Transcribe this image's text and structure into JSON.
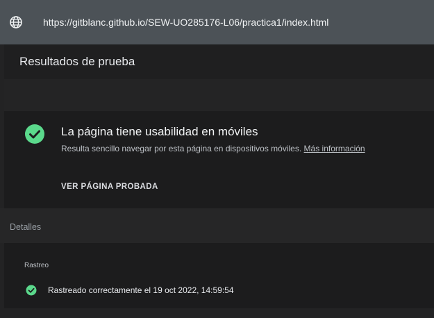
{
  "urlbar": {
    "icon": "globe-icon",
    "url": "https://gitblanc.github.io/SEW-UO285176-L06/practica1/index.html"
  },
  "results": {
    "title": "Resultados de prueba"
  },
  "usability": {
    "icon": "check-circle-icon",
    "headline": "La página tiene usabilidad en móviles",
    "description": "Resulta sencillo navegar por esta página en dispositivos móviles.",
    "link": "Más información",
    "view_button": "VER PÁGINA PROBADA"
  },
  "details": {
    "label": "Detalles",
    "crawl": {
      "section": "Rastreo",
      "icon": "check-circle-icon",
      "status": "Rastreado correctamente el 19 oct 2022, 14:59:54"
    }
  },
  "colors": {
    "success": "#5bd98c",
    "urlbar_bg": "#4c5257",
    "page_bg": "#232324",
    "card_bg": "#1c1c1d"
  }
}
